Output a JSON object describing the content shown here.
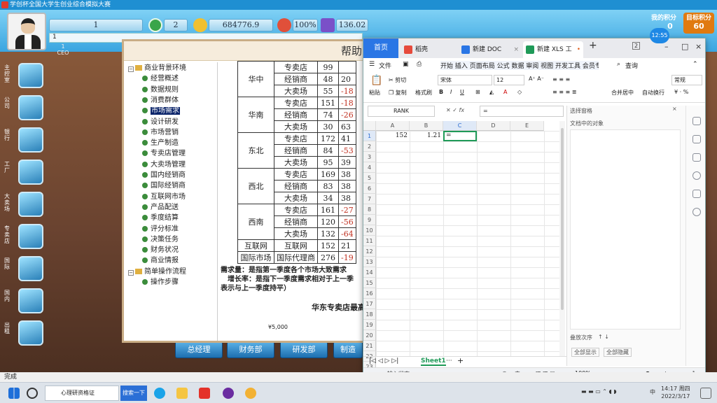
{
  "game": {
    "title": "学创杯全国大学生创业综合模拟大赛",
    "hud": {
      "round": "1",
      "clock_value": "2",
      "cash": "684776.9",
      "percent": "100%",
      "other": "136.02",
      "row2_value": "1",
      "row3_value": "1",
      "row3_label": "CEO"
    },
    "score": {
      "label": "我的积分",
      "value": "0",
      "target_label": "目标积分",
      "target_value": "60"
    },
    "side_nav": [
      "主控室",
      "公司",
      "银行",
      "工厂",
      "大卖场",
      "专卖店",
      "国际",
      "国内",
      "出租"
    ],
    "bottom_tabs": [
      "总经理",
      "财务部",
      "研发部",
      "制造"
    ]
  },
  "help": {
    "title": "帮助",
    "tree": [
      {
        "label": "商业背景环境",
        "level": 0,
        "kind": "folder",
        "toggle": "−"
      },
      {
        "label": "经营概述",
        "level": 1
      },
      {
        "label": "数据规则",
        "level": 1
      },
      {
        "label": "消费群体",
        "level": 1
      },
      {
        "label": "市场需求",
        "level": 1,
        "selected": true
      },
      {
        "label": "设计研发",
        "level": 1
      },
      {
        "label": "市场营销",
        "level": 1
      },
      {
        "label": "生产制造",
        "level": 1
      },
      {
        "label": "专卖店管理",
        "level": 1
      },
      {
        "label": "大卖场管理",
        "level": 1
      },
      {
        "label": "国内经销商",
        "level": 1
      },
      {
        "label": "国际经销商",
        "level": 1
      },
      {
        "label": "互联网市场",
        "level": 1
      },
      {
        "label": "产品配送",
        "level": 1
      },
      {
        "label": "季度结算",
        "level": 1
      },
      {
        "label": "评分标准",
        "level": 1
      },
      {
        "label": "决策任务",
        "level": 1
      },
      {
        "label": "财务状况",
        "level": 1
      },
      {
        "label": "商业情报",
        "level": 1
      },
      {
        "label": "简单操作流程",
        "level": 0,
        "kind": "folder",
        "toggle": "−"
      },
      {
        "label": "操作步骤",
        "level": 1
      }
    ],
    "market_table": [
      {
        "region": "华中",
        "rows": [
          [
            "专卖店",
            "99",
            ""
          ],
          [
            "经销商",
            "48",
            "20"
          ],
          [
            "大卖场",
            "55",
            "-18"
          ]
        ]
      },
      {
        "region": "华南",
        "rows": [
          [
            "专卖店",
            "151",
            "-18"
          ],
          [
            "经销商",
            "74",
            "-26"
          ],
          [
            "大卖场",
            "30",
            "63"
          ]
        ]
      },
      {
        "region": "东北",
        "rows": [
          [
            "专卖店",
            "172",
            "41"
          ],
          [
            "经销商",
            "84",
            "-53"
          ],
          [
            "大卖场",
            "95",
            "39"
          ]
        ]
      },
      {
        "region": "西北",
        "rows": [
          [
            "专卖店",
            "169",
            "38"
          ],
          [
            "经销商",
            "83",
            "38"
          ],
          [
            "大卖场",
            "34",
            "38"
          ]
        ]
      },
      {
        "region": "西南",
        "rows": [
          [
            "专卖店",
            "161",
            "-27"
          ],
          [
            "经销商",
            "120",
            "-56"
          ],
          [
            "大卖场",
            "132",
            "-64"
          ]
        ]
      },
      {
        "region": "互联网",
        "rows": [
          [
            "互联网",
            "152",
            "21"
          ]
        ]
      },
      {
        "region": "国际市场",
        "rows": [
          [
            "国际代理商",
            "276",
            "-19"
          ]
        ]
      }
    ],
    "note1": "需求量：是指第一季度各个市场大致需求",
    "note2": "增长率：是指下一季度需求相对于上一季",
    "note3": "表示与上一季度持平）",
    "chart_title": "华东专卖店最高",
    "chart_axis_label": "¥5,000"
  },
  "wps": {
    "tabs": [
      {
        "label": "首页",
        "icon_color": "#2a76e5"
      },
      {
        "label": "稻壳",
        "icon_color": "#e64a3c"
      },
      {
        "label": "新建 DOC",
        "icon_color": "#2a76e5"
      },
      {
        "label": "新建 XLS 工",
        "icon_color": "#1f9a58",
        "active": true
      }
    ],
    "tab_badge": "2",
    "menu": {
      "file": "文件",
      "ribbon_tabs": "开始 插入 页面布局 公式 数据 审阅 视图 开发工具 会员专享 稻壳资",
      "search": "查询"
    },
    "ribbon": {
      "paste": "粘贴",
      "cut": "剪切",
      "copy": "复制",
      "format_painter": "格式刷",
      "font": "宋体",
      "size": "12",
      "merge": "合并居中",
      "wrap": "自动换行",
      "number_format": "常规"
    },
    "name_box": "RANK",
    "formula_value": "=",
    "columns": [
      "A",
      "B",
      "C",
      "D",
      "E"
    ],
    "rows": [
      "1",
      "2",
      "3",
      "4",
      "5",
      "6",
      "7",
      "8",
      "9",
      "10",
      "11",
      "12",
      "13",
      "14",
      "15",
      "16",
      "17",
      "18",
      "19",
      "20",
      "21",
      "22",
      "23"
    ],
    "cells": {
      "A1": "152",
      "B1": "1.21",
      "C1": "="
    },
    "sheet_tab": "Sheet1",
    "status_input": "输入状态",
    "zoom": "100%",
    "pane": {
      "title": "选择窗格",
      "subtitle": "文档中的对象",
      "show_all": "全部显示",
      "hide_all": "全部隐藏",
      "order": "叠放次序"
    }
  },
  "clock_bubble": "12:55",
  "status_done": "完成",
  "taskbar": {
    "search_placeholder": "心理研资格证",
    "search_button": "搜索一下",
    "ime": "中",
    "time": "14:17 周四",
    "date": "2022/3/17"
  },
  "colors": {
    "wps_accent": "#2a76e5",
    "sheet_green": "#1f9a58",
    "negative_red": "#c03020"
  }
}
